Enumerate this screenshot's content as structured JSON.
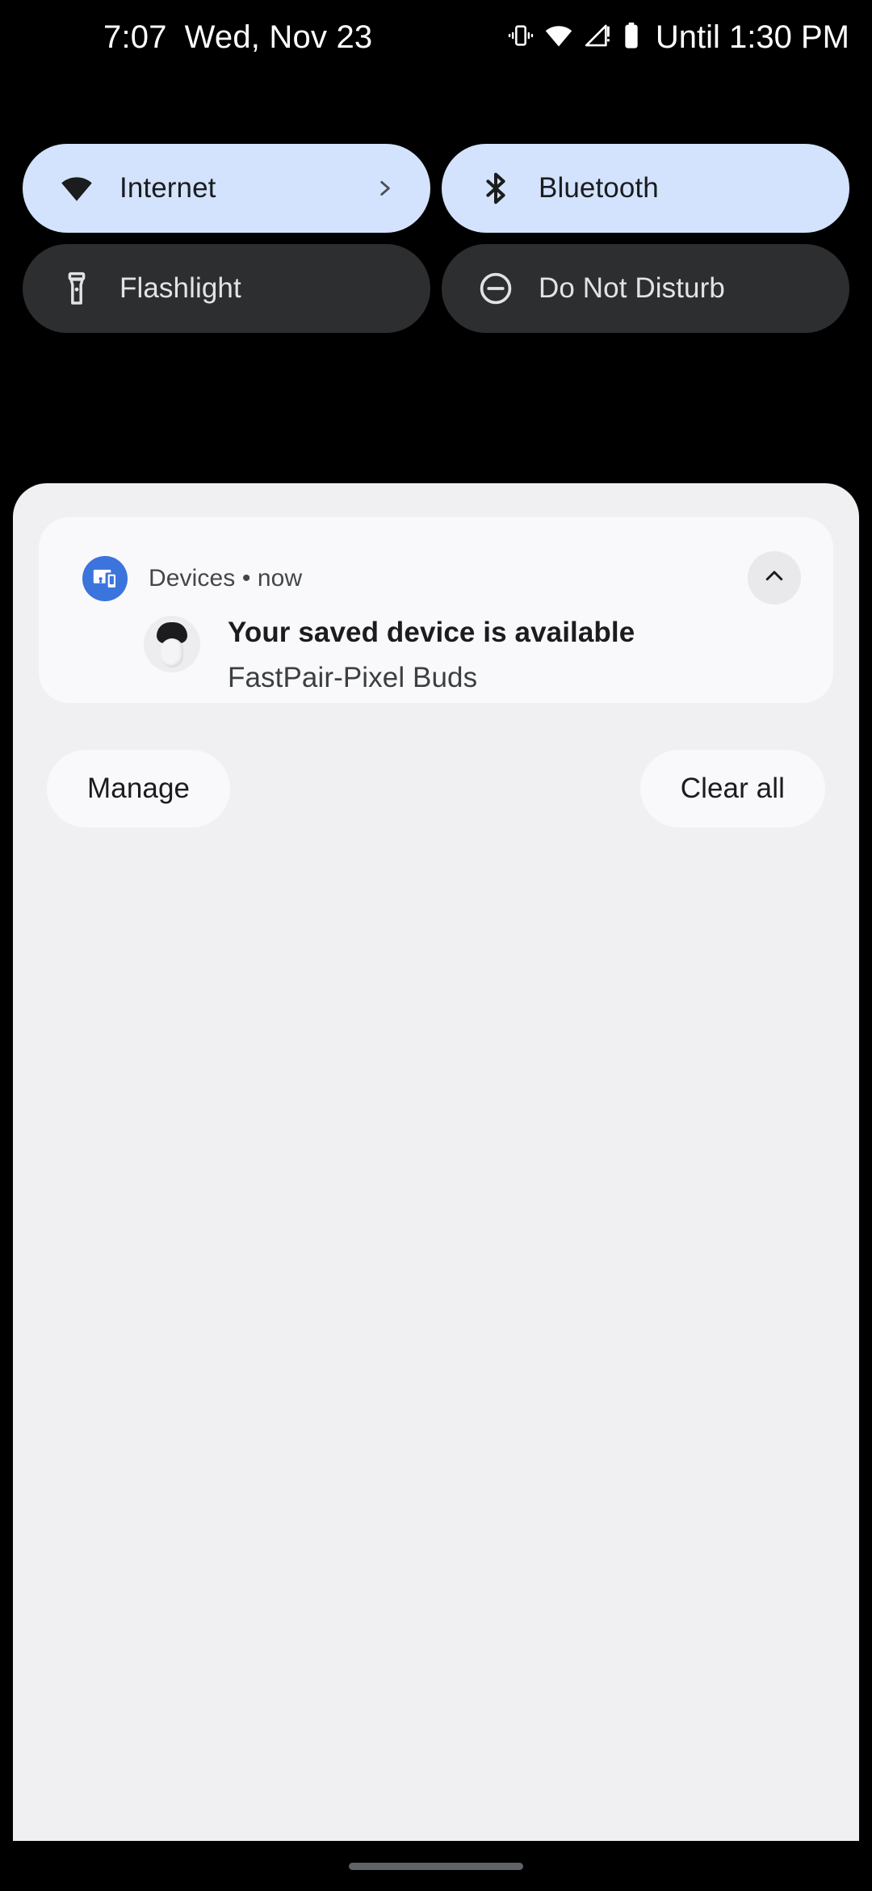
{
  "status_bar": {
    "time": "7:07",
    "date": "Wed, Nov 23",
    "battery_status": "Until 1:30 PM",
    "icons": [
      "vibrate-icon",
      "wifi-icon",
      "mobile-signal-alert-icon",
      "battery-icon"
    ]
  },
  "quick_settings": {
    "tiles": [
      {
        "label": "Internet",
        "icon": "wifi-icon",
        "state": "on",
        "has_chevron": true
      },
      {
        "label": "Bluetooth",
        "icon": "bluetooth-icon",
        "state": "on",
        "has_chevron": false
      },
      {
        "label": "Flashlight",
        "icon": "flashlight-icon",
        "state": "off",
        "has_chevron": false
      },
      {
        "label": "Do Not Disturb",
        "icon": "dnd-icon",
        "state": "off",
        "has_chevron": false
      }
    ]
  },
  "notification_shade": {
    "notification": {
      "app_icon": "devices-icon",
      "source": "Devices",
      "separator": "•",
      "time": "now",
      "title": "Your saved device is available",
      "subtitle": "FastPair-Pixel Buds",
      "collapse_icon": "chevron-up-icon",
      "thumbnail": "pixel-buds-image"
    },
    "manage_label": "Manage",
    "clear_all_label": "Clear all"
  },
  "navigation": {
    "home_handle": "home-gesture-bar"
  },
  "colors": {
    "background": "#000000",
    "tile_active": "#D3E3FD",
    "tile_inactive": "#2C2E30",
    "shade_background": "#F0F0F2",
    "card_background": "#F9F9FB",
    "app_badge": "#3B74DC"
  }
}
